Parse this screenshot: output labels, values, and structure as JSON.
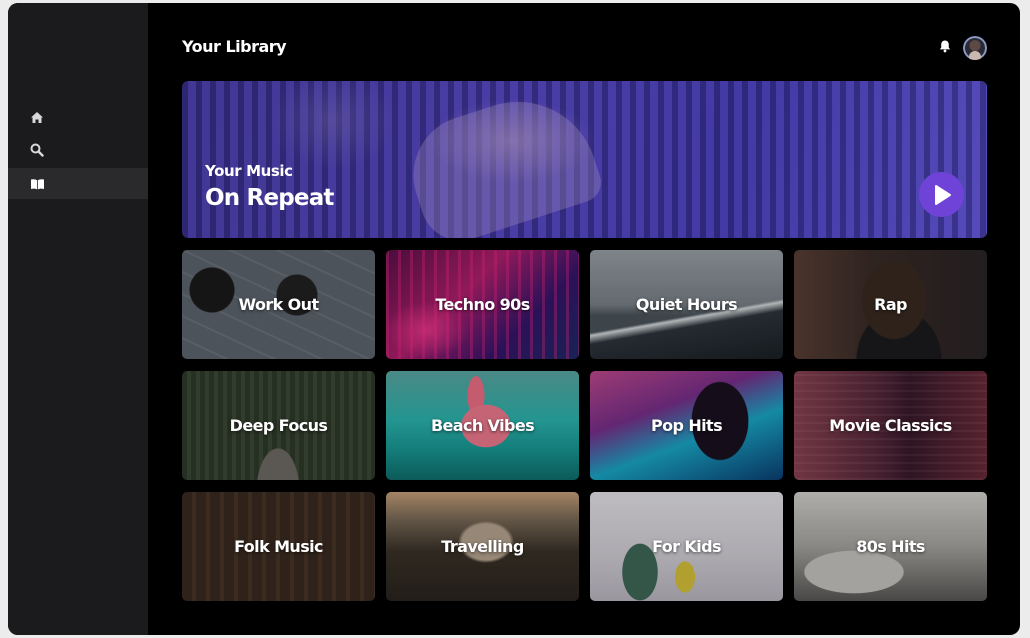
{
  "header": {
    "title": "Your Library",
    "bell_icon": "bell-icon",
    "avatar_icon": "user-avatar"
  },
  "sidebar": {
    "items": [
      {
        "icon": "home-icon",
        "active": false
      },
      {
        "icon": "search-icon",
        "active": false
      },
      {
        "icon": "library-book-icon",
        "active": true
      }
    ]
  },
  "hero": {
    "subtitle": "Your Music",
    "title": "On Repeat",
    "play_icon": "play-icon",
    "accent_color": "#6f43d8"
  },
  "playlists": [
    {
      "label": "Work Out"
    },
    {
      "label": "Techno 90s"
    },
    {
      "label": "Quiet Hours"
    },
    {
      "label": "Rap"
    },
    {
      "label": "Deep Focus"
    },
    {
      "label": "Beach Vibes"
    },
    {
      "label": "Pop Hits"
    },
    {
      "label": "Movie Classics"
    },
    {
      "label": "Folk Music"
    },
    {
      "label": "Travelling"
    },
    {
      "label": "For Kids"
    },
    {
      "label": "80s Hits"
    }
  ],
  "colors": {
    "background": "#000000",
    "sidebar": "#1b1b1d",
    "sidebar_active": "#2a2a2c"
  }
}
